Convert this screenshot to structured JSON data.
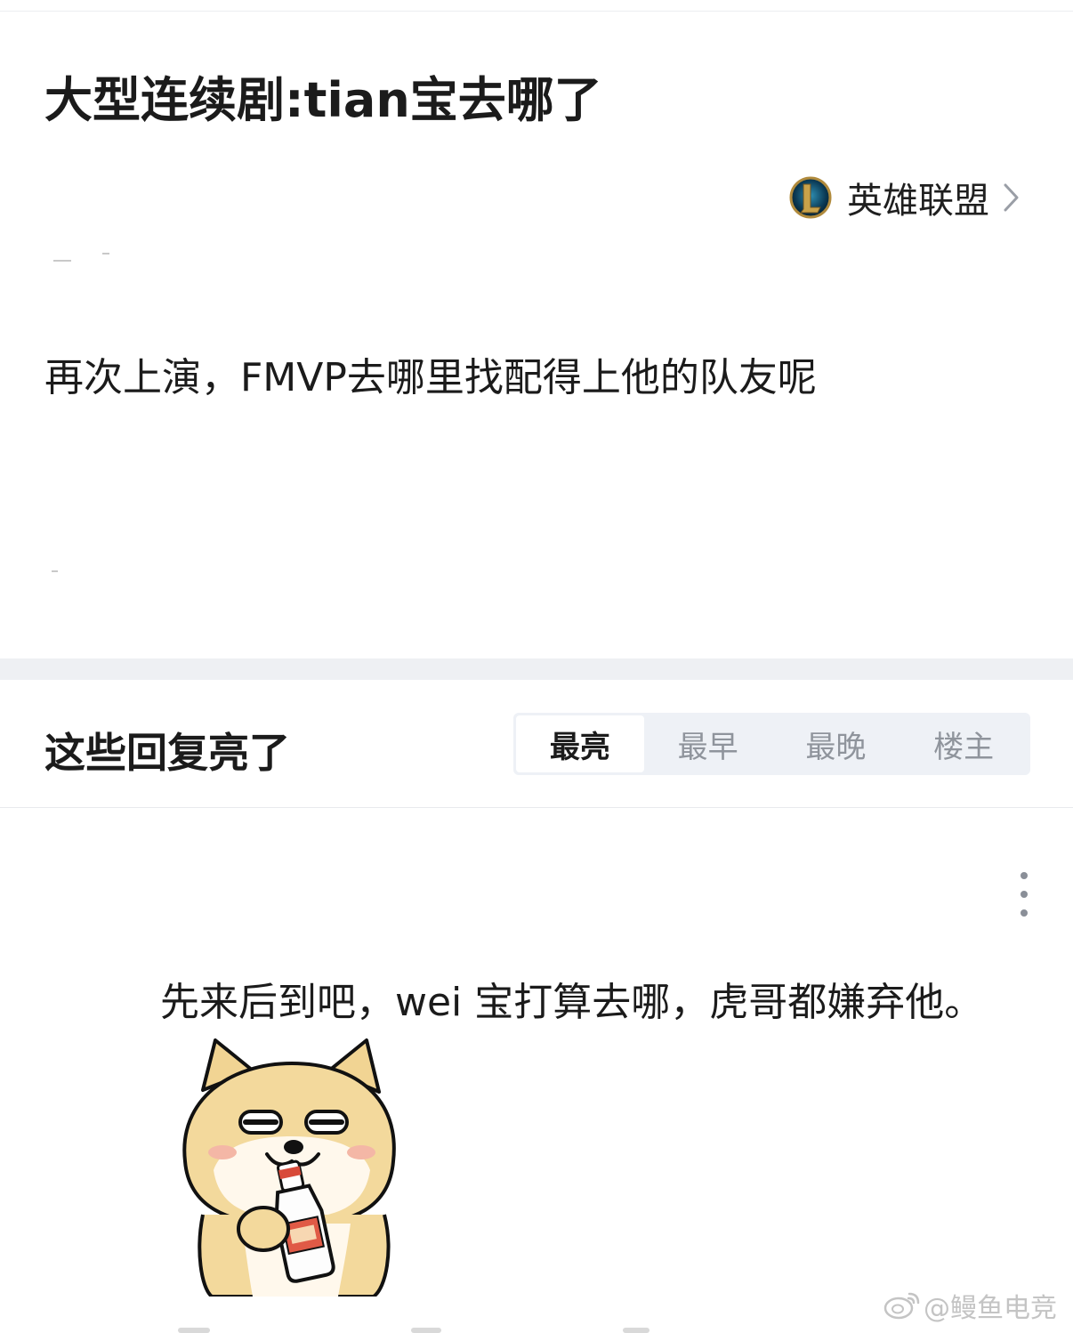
{
  "post": {
    "title": "大型连续剧:tian宝去哪了",
    "forum": {
      "name": "英雄联盟",
      "icon": "league-of-legends-logo"
    },
    "body": "再次上演，FMVP去哪里找配得上他的队友呢"
  },
  "replies": {
    "section_title": "这些回复亮了",
    "sort_tabs": [
      {
        "label": "最亮",
        "active": true
      },
      {
        "label": "最早",
        "active": false
      },
      {
        "label": "最晚",
        "active": false
      },
      {
        "label": "楼主",
        "active": false
      }
    ],
    "items": [
      {
        "text": "先来后到吧，wei 宝打算去哪，虎哥都嫌弃他。",
        "image": "dog-drinking-bottle-sticker",
        "menu_icon": "more-vertical-icon"
      }
    ]
  },
  "watermark": {
    "text": "@鳗鱼电竞",
    "icon": "weibo-icon"
  },
  "colors": {
    "text": "#1b1b1b",
    "muted": "#8f949c",
    "divider": "#eef0f3",
    "tab_bg": "#eef1f6",
    "watermark": "#c4c4c4"
  }
}
